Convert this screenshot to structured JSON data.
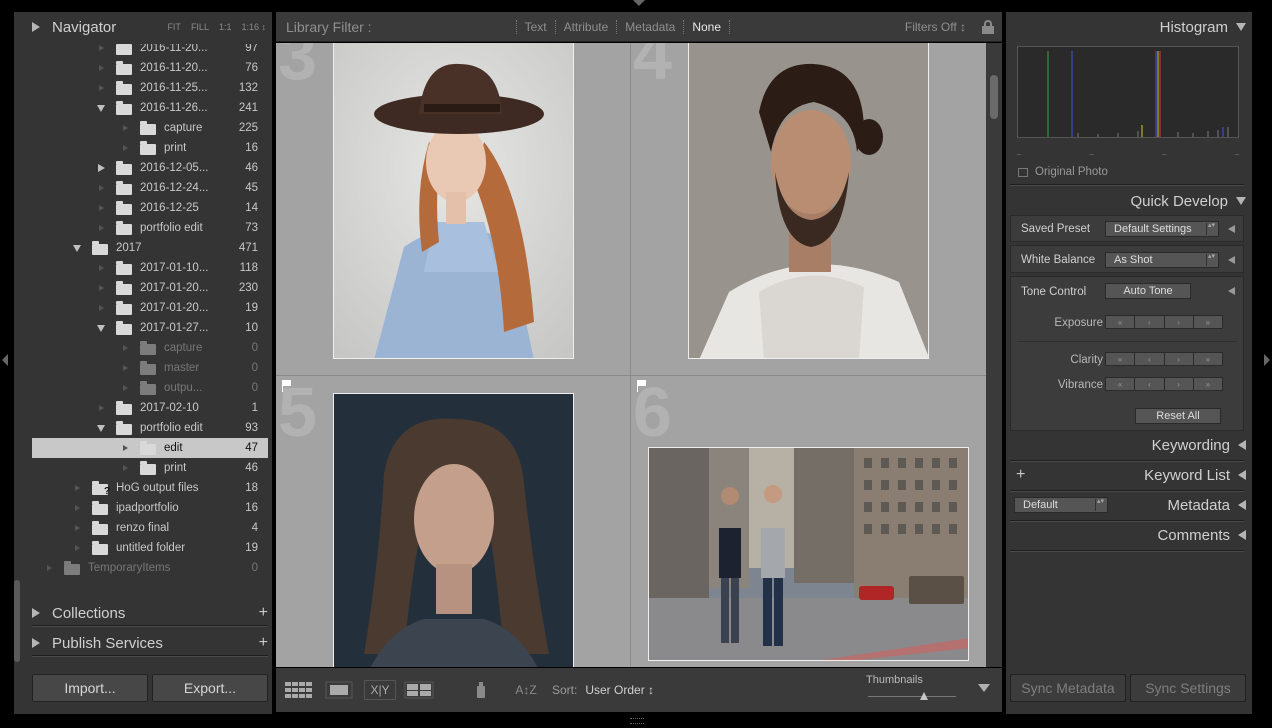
{
  "left_panel": {
    "navigator": {
      "title": "Navigator",
      "zoom_options": [
        "FIT",
        "FILL",
        "1:1",
        "1:16 ↕"
      ]
    },
    "folders": [
      {
        "name": "2016-11-20...",
        "count": "97",
        "level": 2,
        "disc": "none"
      },
      {
        "name": "2016-11-20...",
        "count": "76",
        "level": 2,
        "disc": "none"
      },
      {
        "name": "2016-11-25...",
        "count": "132",
        "level": 2,
        "disc": "none"
      },
      {
        "name": "2016-11-26...",
        "count": "241",
        "level": 2,
        "disc": "down"
      },
      {
        "name": "capture",
        "count": "225",
        "level": 3,
        "disc": "none"
      },
      {
        "name": "print",
        "count": "16",
        "level": 3,
        "disc": "none"
      },
      {
        "name": "2016-12-05...",
        "count": "46",
        "level": 2,
        "disc": "right"
      },
      {
        "name": "2016-12-24...",
        "count": "45",
        "level": 2,
        "disc": "none"
      },
      {
        "name": "2016-12-25",
        "count": "14",
        "level": 2,
        "disc": "none"
      },
      {
        "name": "portfolio edit",
        "count": "73",
        "level": 2,
        "disc": "none"
      },
      {
        "name": "2017",
        "count": "471",
        "level": 1,
        "disc": "down"
      },
      {
        "name": "2017-01-10...",
        "count": "118",
        "level": 2,
        "disc": "none"
      },
      {
        "name": "2017-01-20...",
        "count": "230",
        "level": 2,
        "disc": "none"
      },
      {
        "name": "2017-01-20...",
        "count": "19",
        "level": 2,
        "disc": "none"
      },
      {
        "name": "2017-01-27...",
        "count": "10",
        "level": 2,
        "disc": "down"
      },
      {
        "name": "capture",
        "count": "0",
        "level": 3,
        "disc": "none",
        "dim": true
      },
      {
        "name": "master",
        "count": "0",
        "level": 3,
        "disc": "none",
        "dim": true
      },
      {
        "name": "outpu...",
        "count": "0",
        "level": 3,
        "disc": "none",
        "dim": true
      },
      {
        "name": "2017-02-10",
        "count": "1",
        "level": 2,
        "disc": "none"
      },
      {
        "name": "portfolio edit",
        "count": "93",
        "level": 2,
        "disc": "down"
      },
      {
        "name": "edit",
        "count": "47",
        "level": 3,
        "disc": "none",
        "selected": true
      },
      {
        "name": "print",
        "count": "46",
        "level": 3,
        "disc": "none"
      },
      {
        "name": "HoG output files",
        "count": "18",
        "level": 1,
        "disc": "none",
        "missing": true
      },
      {
        "name": "ipadportfolio",
        "count": "16",
        "level": 1,
        "disc": "none"
      },
      {
        "name": "renzo final",
        "count": "4",
        "level": 1,
        "disc": "none"
      },
      {
        "name": "untitled folder",
        "count": "19",
        "level": 1,
        "disc": "none"
      },
      {
        "name": "TemporaryItems",
        "count": "0",
        "level": 0,
        "disc": "none",
        "dim": true
      }
    ],
    "missing_mark": "?",
    "collections": {
      "title": "Collections",
      "plus": "+"
    },
    "publish": {
      "title": "Publish Services",
      "plus": "+"
    },
    "import_label": "Import...",
    "export_label": "Export..."
  },
  "filter_bar": {
    "label": "Library Filter :",
    "items": [
      "Text",
      "Attribute",
      "Metadata",
      "None"
    ],
    "active": "None",
    "filters_off": "Filters Off ↕"
  },
  "grid": {
    "cells": [
      {
        "index": "3",
        "photo": "woman-hat"
      },
      {
        "index": "4",
        "photo": "man-portrait"
      },
      {
        "index": "5",
        "photo": "woman-portrait"
      },
      {
        "index": "6",
        "photo": "two-men-street"
      }
    ]
  },
  "toolbar": {
    "sort_label": "Sort:",
    "sort_value": "User Order ↕",
    "thumbnails_label": "Thumbnails",
    "view_modes": [
      "grid-view-icon",
      "loupe-view-icon",
      "compare-view-icon",
      "survey-view-icon"
    ],
    "compare_text": "X|Y",
    "sort_icon_text": "A↕Z"
  },
  "right_panel": {
    "histogram": {
      "title": "Histogram",
      "original_photo": "Original Photo",
      "ticks": [
        "–",
        "–",
        "–",
        "–"
      ]
    },
    "quick_develop": {
      "title": "Quick Develop",
      "saved_preset_label": "Saved Preset",
      "saved_preset_value": "Default Settings",
      "white_balance_label": "White Balance",
      "white_balance_value": "As Shot",
      "tone_control_label": "Tone Control",
      "auto_tone": "Auto Tone",
      "exposure_label": "Exposure",
      "clarity_label": "Clarity",
      "vibrance_label": "Vibrance",
      "stepper_glyphs": [
        "«",
        "‹",
        "›",
        "»"
      ],
      "spin_glyph": "▴▾",
      "reset_all": "Reset All"
    },
    "keywording": {
      "title": "Keywording"
    },
    "keyword_list": {
      "title": "Keyword List",
      "plus": "+"
    },
    "metadata": {
      "title": "Metadata",
      "preset": "Default"
    },
    "comments": {
      "title": "Comments"
    },
    "sync_metadata": "Sync Metadata",
    "sync_settings": "Sync Settings"
  },
  "colors": {
    "panel_bg": "#343434",
    "grid_bg": "#a3a3a3",
    "selected_row": "#c8c8c8"
  }
}
